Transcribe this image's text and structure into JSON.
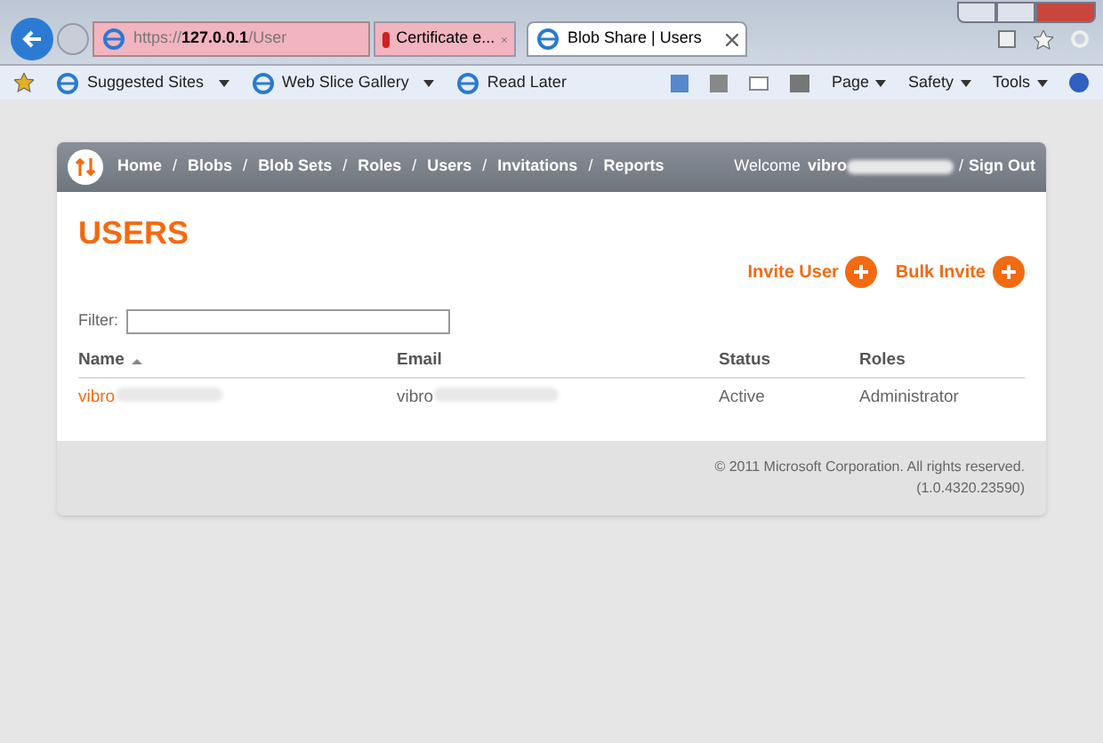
{
  "browser": {
    "address": "https://**127.0.0.1**/User",
    "tabs": [
      {
        "title": "Certificate e...",
        "kind": "error",
        "selected": false
      },
      {
        "title": "Blob Share | Users",
        "kind": "page",
        "selected": true
      }
    ],
    "favorites": [
      "Suggested Sites",
      "Web Slice Gallery",
      "Read Later"
    ],
    "commands": [
      "Page",
      "Safety",
      "Tools"
    ]
  },
  "nav": {
    "items": [
      "Home",
      "Blobs",
      "Blob Sets",
      "Roles",
      "Users",
      "Invitations",
      "Reports"
    ],
    "separators": [
      "/",
      "/",
      "/",
      "/",
      "/",
      "/",
      "/"
    ],
    "welcome": "Welcome",
    "user": "vibro",
    "sign_out": "Sign Out"
  },
  "title": "USERS",
  "actions": [
    "Invite User",
    "Bulk Invite"
  ],
  "filter": {
    "label": "Filter:"
  },
  "table": {
    "columns": [
      {
        "label": "Name",
        "sorted": true
      },
      {
        "label": "Email",
        "sorted": false
      },
      {
        "label": "Status",
        "sorted": false
      },
      {
        "label": "Roles",
        "sorted": false
      }
    ],
    "rows": [
      {
        "name": "vibro",
        "email": "vibro",
        "status": "Active",
        "roles": "Administrator"
      }
    ]
  },
  "footer": [
    "© 2011 Microsoft Corporation. All rights reserved.",
    "(1.0.4320.23590)"
  ]
}
